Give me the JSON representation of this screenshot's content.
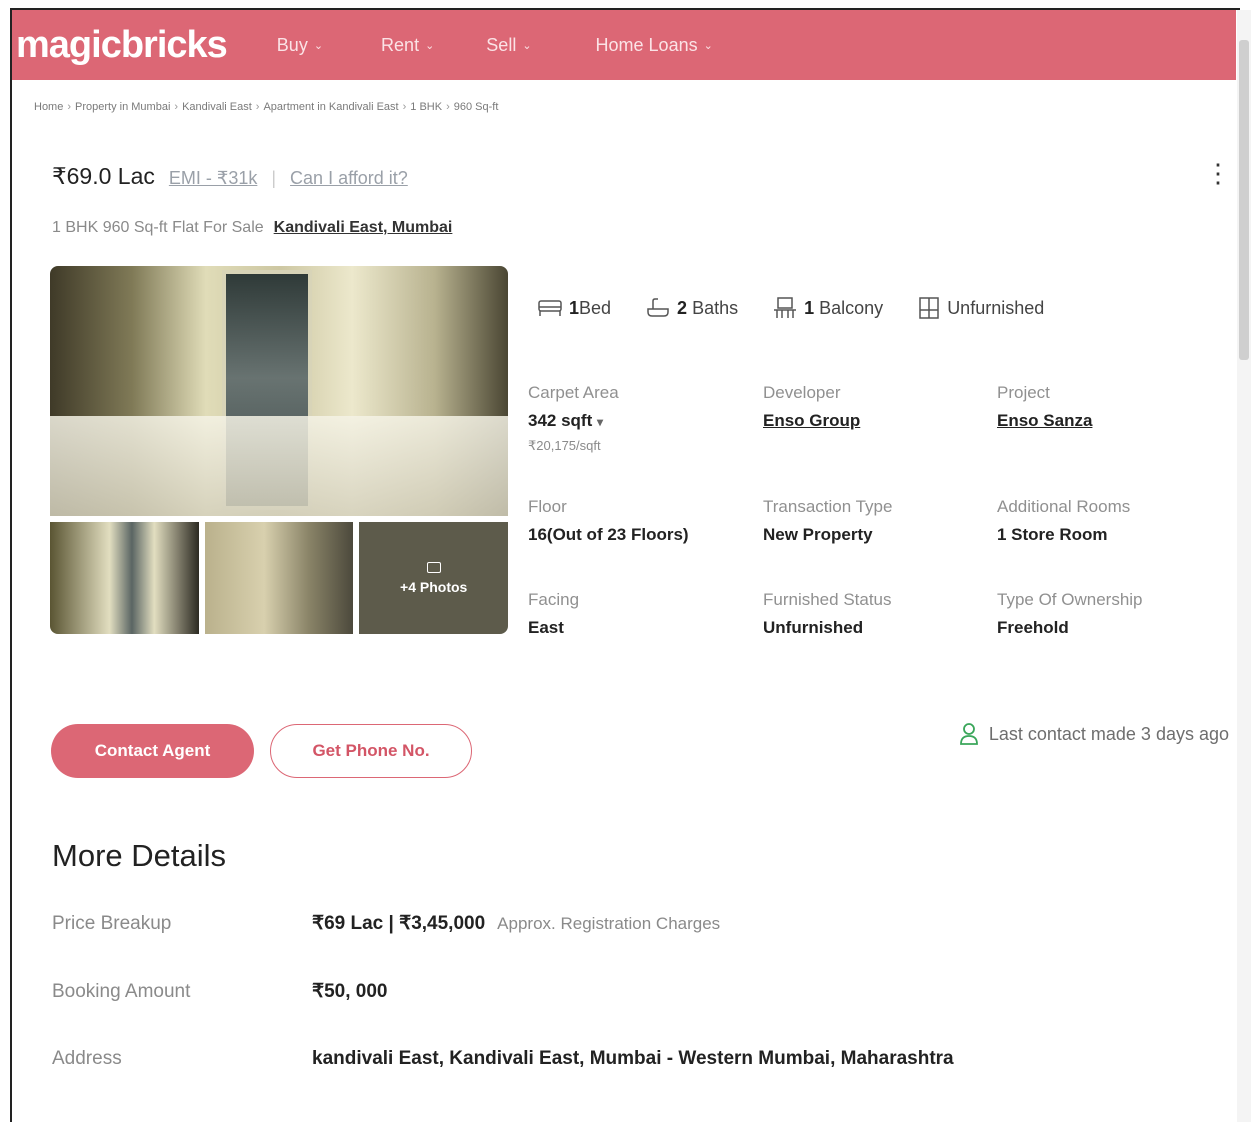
{
  "nav": {
    "logo": "magicbricks",
    "items": [
      {
        "label": "Buy",
        "chevron": "⌄"
      },
      {
        "label": "Rent",
        "chevron": "⌄"
      },
      {
        "label": "Sell",
        "chevron": "⌄"
      },
      {
        "label": "Home Loans",
        "chevron": "⌄"
      }
    ]
  },
  "breadcrumb": [
    "Home",
    "Property in Mumbai",
    "Kandivali East",
    "Apartment in Kandivali East",
    "1 BHK",
    "960 Sq-ft"
  ],
  "breadcrumb_separator": "›",
  "listing": {
    "price": "₹69.0 Lac",
    "emi": "EMI - ₹31k",
    "afford": "Can I afford it?",
    "divider": "|",
    "menu_glyph": "⋮",
    "subtitle": "1 BHK 960 Sq-ft Flat For Sale",
    "location": "Kandivali East, Mumbai",
    "more_photos": "+4 Photos"
  },
  "amenities": [
    {
      "icon": "bed-icon",
      "count": "1",
      "label": "Bed"
    },
    {
      "icon": "bath-icon",
      "count": "2",
      "label": "Baths"
    },
    {
      "icon": "balcony-icon",
      "count": "1",
      "label": "Balcony"
    },
    {
      "icon": "furniture-icon",
      "count": "",
      "label": "Unfurnished"
    }
  ],
  "facts": {
    "carpet_area": {
      "label": "Carpet Area",
      "value": "342 sqft",
      "dropdown": "▾",
      "sub": "₹20,175/sqft"
    },
    "developer": {
      "label": "Developer",
      "value": "Enso Group"
    },
    "project": {
      "label": "Project",
      "value": "Enso Sanza"
    },
    "floor": {
      "label": "Floor",
      "value": "16(Out of 23 Floors)"
    },
    "transaction": {
      "label": "Transaction Type",
      "value": "New Property"
    },
    "additional_rooms": {
      "label": "Additional Rooms",
      "value": "1 Store Room"
    },
    "facing": {
      "label": "Facing",
      "value": "East"
    },
    "furnished": {
      "label": "Furnished Status",
      "value": "Unfurnished"
    },
    "ownership": {
      "label": "Type Of Ownership",
      "value": "Freehold"
    }
  },
  "actions": {
    "contact_agent": "Contact Agent",
    "get_phone": "Get Phone No.",
    "last_contact": "Last contact made 3 days ago"
  },
  "more_details": {
    "title": "More Details",
    "price_breakup": {
      "label": "Price Breakup",
      "value": "₹69 Lac | ₹3,45,000",
      "note": "Approx. Registration Charges"
    },
    "booking_amount": {
      "label": "Booking Amount",
      "value": "₹50, 000"
    },
    "address": {
      "label": "Address",
      "value": "kandivali East, Kandivali East, Mumbai - Western Mumbai, Maharashtra"
    }
  },
  "colors": {
    "brand": "#dc6775",
    "text": "#222222",
    "muted": "#8a8a8a",
    "green": "#3aa65a"
  }
}
